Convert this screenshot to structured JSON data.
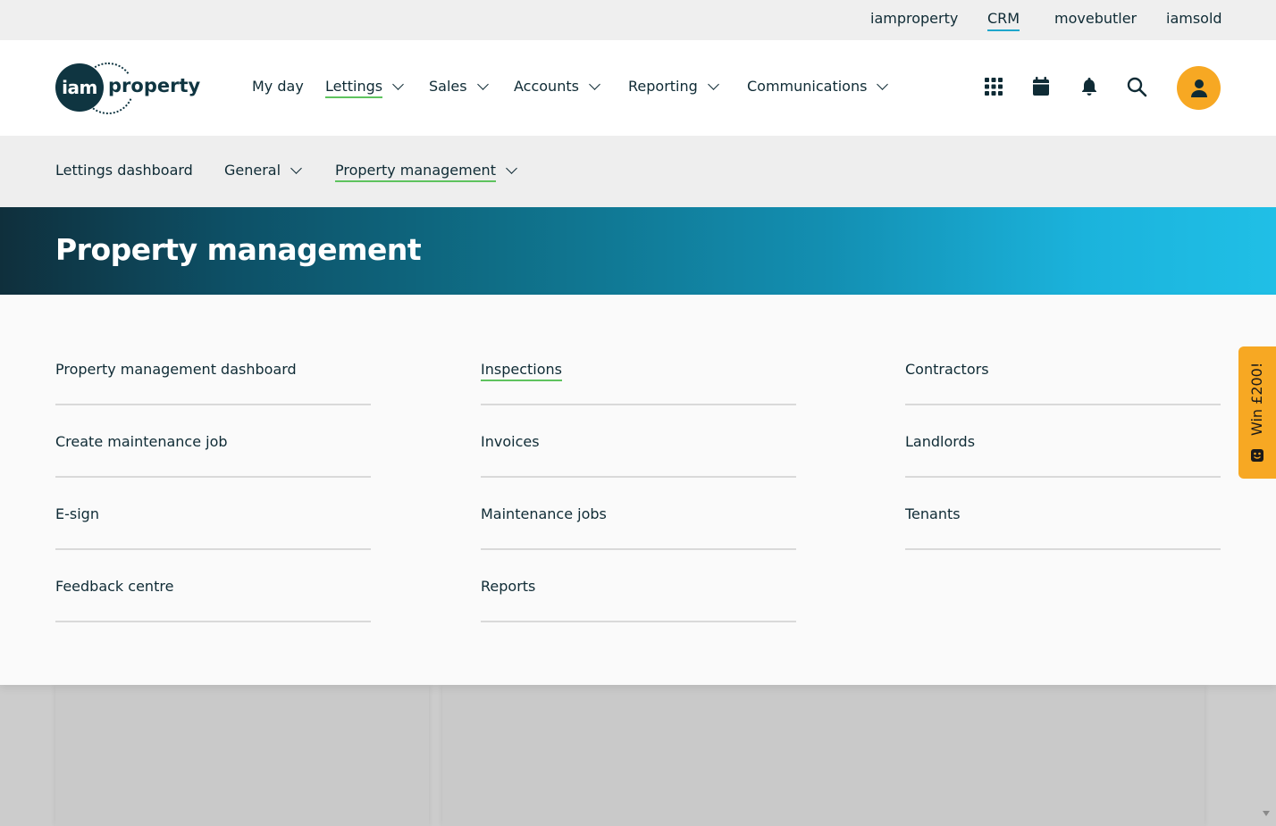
{
  "topbar": {
    "links": {
      "iamproperty": "iamproperty",
      "crm": "CRM",
      "movebutler": "movebutler",
      "iamsold": "iamsold"
    }
  },
  "logo": {
    "badge": "iam",
    "word": "property"
  },
  "nav": {
    "my_day": "My day",
    "lettings": "Lettings",
    "sales": "Sales",
    "accounts": "Accounts",
    "reporting": "Reporting",
    "communications": "Communications"
  },
  "header_icons": [
    "apps-grid-icon",
    "calendar-icon",
    "bell-icon",
    "search-icon",
    "user-icon"
  ],
  "subnav": {
    "lettings_dashboard": "Lettings dashboard",
    "general": "General",
    "property_management": "Property management"
  },
  "banner": {
    "title": "Property management"
  },
  "menu": {
    "col1": [
      "Property management dashboard",
      "Create maintenance job",
      "E-sign",
      "Feedback centre"
    ],
    "col2": [
      "Inspections",
      "Invoices",
      "Maintenance jobs",
      "Reports"
    ],
    "col3": [
      "Contractors",
      "Landlords",
      "Tenants"
    ]
  },
  "win_tab": {
    "label": "Win £200!"
  },
  "colors": {
    "primary_dark": "#0f3541",
    "accent_orange": "#f7a823",
    "active_underline": "#5ec35e",
    "crm_underline": "#1ea6cc",
    "banner_start": "#0f2f3c",
    "banner_end": "#20bfe6"
  }
}
